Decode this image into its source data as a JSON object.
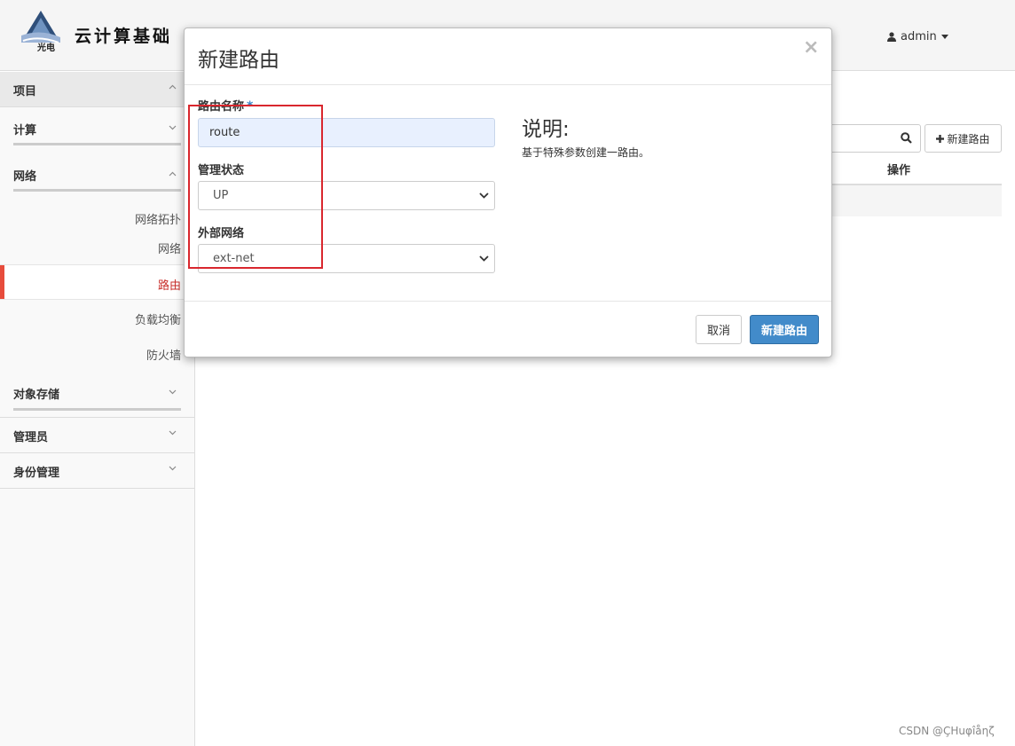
{
  "app": {
    "brand_title": "云计算基础",
    "user_label": "admin",
    "user_icon": "user-icon"
  },
  "sidebar": {
    "project": "项目",
    "compute": "计算",
    "network": "网络",
    "network_items": [
      {
        "label": "网络拓扑",
        "active": false
      },
      {
        "label": "网络",
        "active": false
      },
      {
        "label": "路由",
        "active": true
      },
      {
        "label": "负载均衡",
        "active": false
      },
      {
        "label": "防火墙",
        "active": false
      }
    ],
    "object_storage": "对象存储",
    "admin": "管理员",
    "identity": "身份管理"
  },
  "main": {
    "create_button": "新建路由",
    "actions_column": "操作"
  },
  "modal": {
    "title": "新建路由",
    "close": "×",
    "router_name_label": "路由名称",
    "required_marker": "*",
    "router_name_value": "route",
    "admin_state_label": "管理状态",
    "admin_state_value": "UP",
    "external_network_label": "外部网络",
    "external_network_value": "ext-net",
    "help_title": "说明:",
    "help_text": "基于特殊参数创建一路由。",
    "cancel_button": "取消",
    "submit_button": "新建路由"
  },
  "colors": {
    "accent_blue": "#428bca",
    "active_red": "#e74c3c",
    "highlight_red": "#d9272e"
  },
  "watermark": "CSDN @ÇHuφîåηζ"
}
